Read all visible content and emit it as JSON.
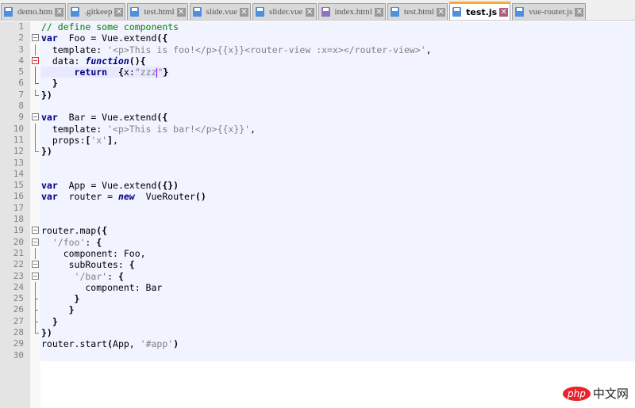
{
  "tabs": [
    {
      "label": "demo.htm",
      "icon": "blue",
      "active": false
    },
    {
      "label": ".gitkeep",
      "icon": "blue",
      "active": false
    },
    {
      "label": "test.html",
      "icon": "blue",
      "active": false
    },
    {
      "label": "slide.vue",
      "icon": "blue",
      "active": false
    },
    {
      "label": "slider.vue",
      "icon": "blue",
      "active": false
    },
    {
      "label": "index.html",
      "icon": "purple",
      "active": false
    },
    {
      "label": "test.html",
      "icon": "blue",
      "active": false
    },
    {
      "label": "test.js",
      "icon": "blue",
      "active": true
    },
    {
      "label": "vue-router.js",
      "icon": "blue",
      "active": false
    }
  ],
  "close_glyph": "✕",
  "colors": {
    "blue": "#4f8fe0",
    "purple": "#9070c0",
    "accent": "#fba935"
  },
  "current_line": 5,
  "lines": [
    {
      "n": "1",
      "fold": "",
      "tokens": [
        [
          "cmt",
          "// define some components"
        ]
      ]
    },
    {
      "n": "2",
      "fold": "box",
      "tokens": [
        [
          "kw",
          "var"
        ],
        [
          "",
          "  Foo = Vue.extend"
        ],
        [
          "op",
          "({"
        ]
      ]
    },
    {
      "n": "3",
      "fold": "v",
      "tokens": [
        [
          "",
          "  template: "
        ],
        [
          "str",
          "'<p>This is foo!</p>{{x}}<router-view :x=x></router-view>'"
        ],
        [
          "",
          ","
        ]
      ]
    },
    {
      "n": "4",
      "fold": "boxred",
      "tokens": [
        [
          "",
          "  data: "
        ],
        [
          "kwi",
          "function"
        ],
        [
          "op",
          "(){"
        ]
      ]
    },
    {
      "n": "5",
      "fold": "vred",
      "tokens": [
        [
          "",
          "      "
        ],
        [
          "kw",
          "return"
        ],
        [
          "",
          "  "
        ],
        [
          "op",
          "{"
        ],
        [
          "",
          "x:"
        ],
        [
          "str",
          "\"zzz"
        ],
        [
          "caret",
          ""
        ],
        [
          "str",
          "\""
        ],
        [
          "op",
          "}"
        ]
      ]
    },
    {
      "n": "6",
      "fold": "endred",
      "tokens": [
        [
          "",
          "  "
        ],
        [
          "op",
          "}"
        ]
      ]
    },
    {
      "n": "7",
      "fold": "end",
      "tokens": [
        [
          "op",
          "})"
        ]
      ]
    },
    {
      "n": "8",
      "fold": "",
      "tokens": []
    },
    {
      "n": "9",
      "fold": "box",
      "tokens": [
        [
          "kw",
          "var"
        ],
        [
          "",
          "  Bar = Vue.extend"
        ],
        [
          "op",
          "({"
        ]
      ]
    },
    {
      "n": "10",
      "fold": "v",
      "tokens": [
        [
          "",
          "  template: "
        ],
        [
          "str",
          "'<p>This is bar!</p>{{x}}'"
        ],
        [
          "",
          ","
        ]
      ]
    },
    {
      "n": "11",
      "fold": "v",
      "tokens": [
        [
          "",
          "  props:"
        ],
        [
          "op",
          "["
        ],
        [
          "str",
          "'x'"
        ],
        [
          "op",
          "]"
        ],
        [
          "",
          ","
        ]
      ]
    },
    {
      "n": "12",
      "fold": "end",
      "tokens": [
        [
          "op",
          "})"
        ]
      ]
    },
    {
      "n": "13",
      "fold": "",
      "tokens": []
    },
    {
      "n": "14",
      "fold": "",
      "tokens": []
    },
    {
      "n": "15",
      "fold": "",
      "tokens": [
        [
          "kw",
          "var"
        ],
        [
          "",
          "  App = Vue.extend"
        ],
        [
          "op",
          "({})"
        ]
      ]
    },
    {
      "n": "16",
      "fold": "",
      "tokens": [
        [
          "kw",
          "var"
        ],
        [
          "",
          "  router = "
        ],
        [
          "kwi",
          "new"
        ],
        [
          "",
          "  VueRouter"
        ],
        [
          "op",
          "()"
        ]
      ]
    },
    {
      "n": "17",
      "fold": "",
      "tokens": []
    },
    {
      "n": "18",
      "fold": "",
      "tokens": []
    },
    {
      "n": "19",
      "fold": "box",
      "tokens": [
        [
          "",
          "router.map"
        ],
        [
          "op",
          "({"
        ]
      ]
    },
    {
      "n": "20",
      "fold": "box",
      "tokens": [
        [
          "",
          "  "
        ],
        [
          "str",
          "'/foo'"
        ],
        [
          "",
          ": "
        ],
        [
          "op",
          "{"
        ]
      ]
    },
    {
      "n": "21",
      "fold": "v",
      "tokens": [
        [
          "",
          "    component: Foo,"
        ]
      ]
    },
    {
      "n": "22",
      "fold": "box",
      "tokens": [
        [
          "",
          "     subRoutes: "
        ],
        [
          "op",
          "{"
        ]
      ]
    },
    {
      "n": "23",
      "fold": "box",
      "tokens": [
        [
          "",
          "      "
        ],
        [
          "str",
          "'/bar'"
        ],
        [
          "",
          ": "
        ],
        [
          "op",
          "{"
        ]
      ]
    },
    {
      "n": "24",
      "fold": "v",
      "tokens": [
        [
          "",
          "        component: Bar"
        ]
      ]
    },
    {
      "n": "25",
      "fold": "tee",
      "tokens": [
        [
          "",
          "      "
        ],
        [
          "op",
          "}"
        ]
      ]
    },
    {
      "n": "26",
      "fold": "tee",
      "tokens": [
        [
          "",
          "     "
        ],
        [
          "op",
          "}"
        ]
      ]
    },
    {
      "n": "27",
      "fold": "tee",
      "tokens": [
        [
          "",
          "  "
        ],
        [
          "op",
          "}"
        ]
      ]
    },
    {
      "n": "28",
      "fold": "end",
      "tokens": [
        [
          "op",
          "})"
        ]
      ]
    },
    {
      "n": "29",
      "fold": "",
      "tokens": [
        [
          "",
          "router.start"
        ],
        [
          "op",
          "("
        ],
        [
          "",
          "App, "
        ],
        [
          "str",
          "'#app'"
        ],
        [
          "op",
          ")"
        ]
      ]
    },
    {
      "n": "30",
      "fold": "",
      "tokens": []
    }
  ],
  "watermark": {
    "brand": "php",
    "text": "中文网"
  }
}
